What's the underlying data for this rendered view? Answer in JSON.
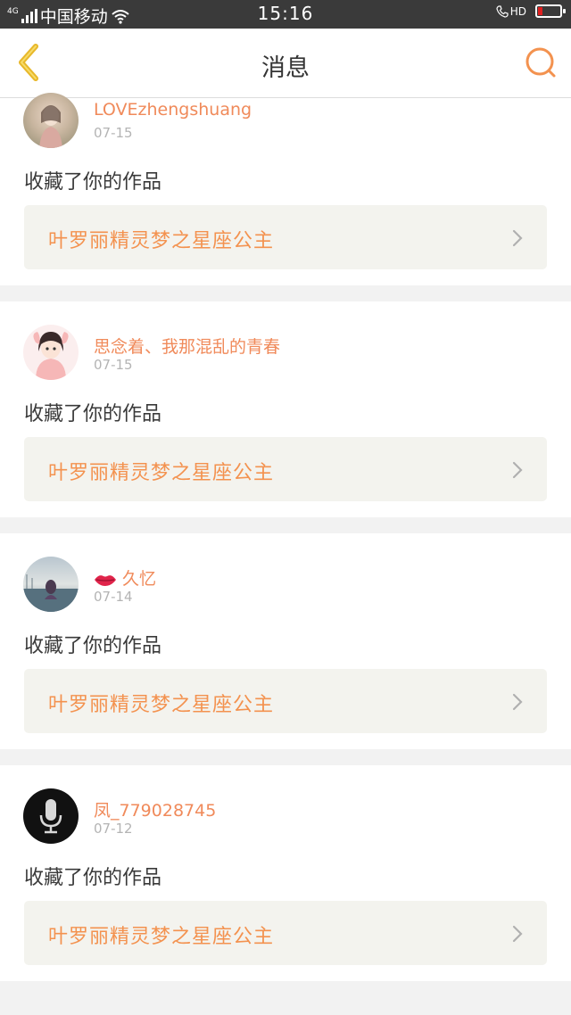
{
  "status_bar": {
    "network": "4G",
    "carrier": "中国移动",
    "time": "15:16",
    "hd": "HD",
    "battery_level": 0.12,
    "battery_color": "#e02020"
  },
  "header": {
    "title": "消息",
    "back_icon": "chevron-left-icon",
    "search_icon": "search-icon",
    "accent_color": "#f3924f",
    "back_color": "#e8b82a"
  },
  "messages": [
    {
      "username": "LOVEzhengshuang",
      "date": "07-15",
      "action": "收藏了你的作品",
      "work_title": "叶罗丽精灵梦之星座公主"
    },
    {
      "username": "思念着、我那混乱的青春",
      "date": "07-15",
      "action": "收藏了你的作品",
      "work_title": "叶罗丽精灵梦之星座公主"
    },
    {
      "username": "久忆",
      "date": "07-14",
      "action": "收藏了你的作品",
      "work_title": "叶罗丽精灵梦之星座公主"
    },
    {
      "username": "凤_779028745",
      "date": "07-12",
      "action": "收藏了你的作品",
      "work_title": "叶罗丽精灵梦之星座公主"
    }
  ]
}
